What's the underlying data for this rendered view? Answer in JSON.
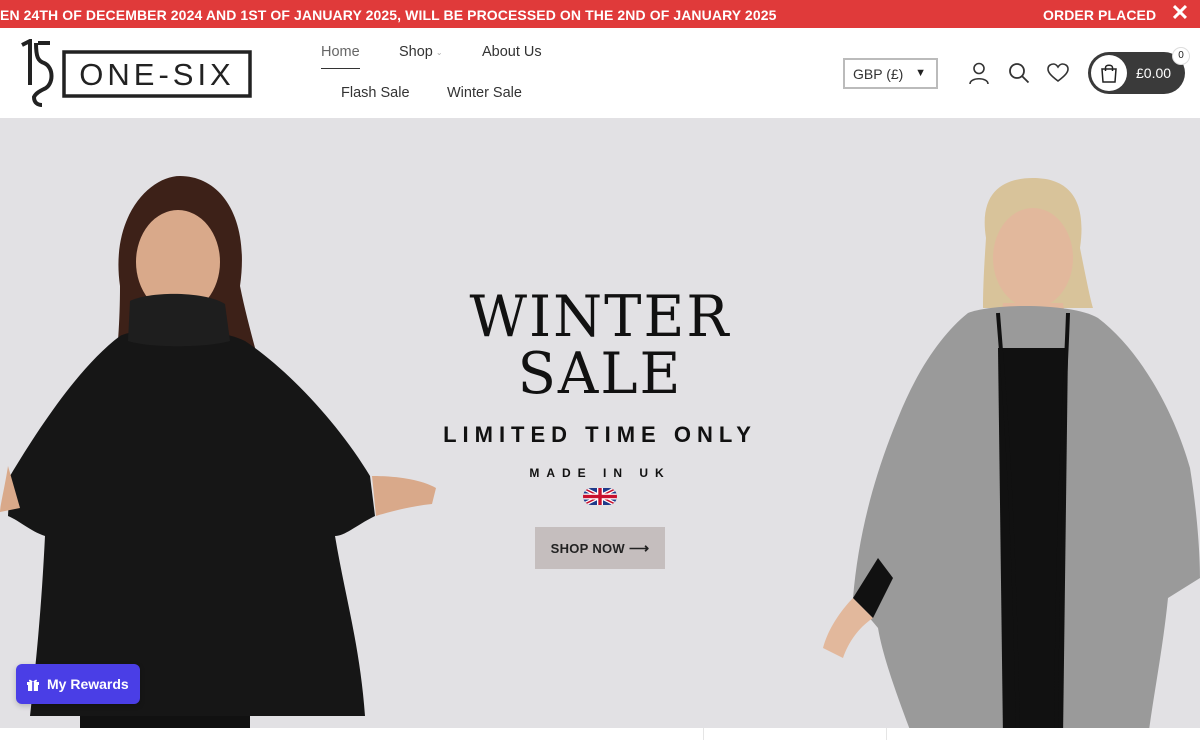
{
  "announcement": {
    "text_primary": "EN 24TH OF DECEMBER 2024 AND 1ST OF JANUARY 2025, WILL BE PROCESSED ON THE 2ND OF JANUARY 2025",
    "text_secondary": "ORDER PLACED BETW",
    "close_glyph": "✕",
    "bg_color": "#e03a3a"
  },
  "brand": {
    "logo_text": "ONE-SIX",
    "logo_mark": "16"
  },
  "nav": {
    "home": "Home",
    "shop": "Shop",
    "about": "About Us",
    "flash_sale": "Flash Sale",
    "winter_sale": "Winter Sale"
  },
  "currency": {
    "selected": "GBP (£)",
    "arrow": "▼"
  },
  "header_icons": [
    "user-icon",
    "search-icon",
    "heart-icon"
  ],
  "cart": {
    "total": "£0.00",
    "count": "0"
  },
  "hero": {
    "headline_line1": "WINTER",
    "headline_line2": "SALE",
    "subheading": "LIMITED TIME ONLY",
    "made_in": "MADE IN UK",
    "cta_label": "SHOP NOW",
    "cta_arrow": "⟶",
    "bg_color": "#e2e1e4",
    "cta_color": "#c5bebe"
  },
  "rewards": {
    "label": "My Rewards",
    "color": "#4a3ee6"
  }
}
